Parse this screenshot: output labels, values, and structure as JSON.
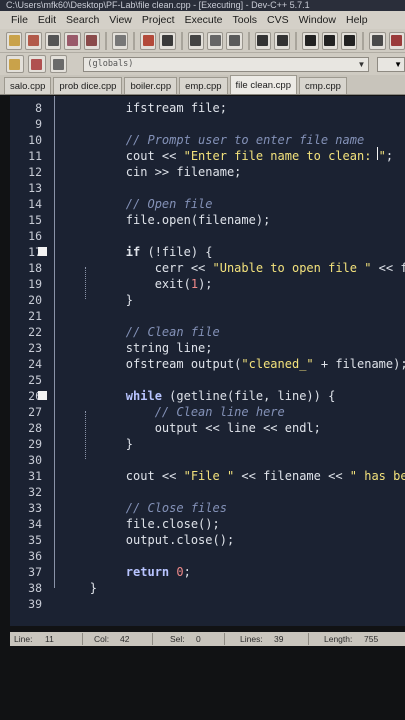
{
  "window": {
    "title": "C:\\Users\\mfk60\\Desktop\\PF-Lab\\file clean.cpp - [Executing] - Dev-C++ 5.7.1"
  },
  "menu": [
    "File",
    "Edit",
    "Search",
    "View",
    "Project",
    "Execute",
    "Tools",
    "CVS",
    "Window",
    "Help"
  ],
  "toolbar2": {
    "class_combo": "(globals)"
  },
  "tabs": [
    {
      "label": "salo.cpp",
      "active": false
    },
    {
      "label": "prob dice.cpp",
      "active": false
    },
    {
      "label": "boiler.cpp",
      "active": false
    },
    {
      "label": "emp.cpp",
      "active": false
    },
    {
      "label": "file clean.cpp",
      "active": true
    },
    {
      "label": "cmp.cpp",
      "active": false
    }
  ],
  "editor": {
    "lines": [
      {
        "n": "8",
        "code": [
          [
            "ind",
            "        "
          ],
          [
            "id",
            "ifstream file;"
          ]
        ]
      },
      {
        "n": "9",
        "code": []
      },
      {
        "n": "10",
        "code": [
          [
            "ind",
            "        "
          ],
          [
            "cm",
            "// Prompt user to enter file name"
          ]
        ]
      },
      {
        "n": "11",
        "code": [
          [
            "ind",
            "        "
          ],
          [
            "id",
            "cout << "
          ],
          [
            "str",
            "\"Enter file name to clean: \""
          ],
          [
            "id",
            ";"
          ]
        ]
      },
      {
        "n": "12",
        "code": [
          [
            "ind",
            "        "
          ],
          [
            "id",
            "cin >> filename;"
          ]
        ]
      },
      {
        "n": "13",
        "code": []
      },
      {
        "n": "14",
        "code": [
          [
            "ind",
            "        "
          ],
          [
            "cm",
            "// Open file"
          ]
        ]
      },
      {
        "n": "15",
        "code": [
          [
            "ind",
            "        "
          ],
          [
            "id",
            "file.open(filename);"
          ]
        ]
      },
      {
        "n": "16",
        "code": []
      },
      {
        "n": "17",
        "code": [
          [
            "ind",
            "        "
          ],
          [
            "kw",
            "if"
          ],
          [
            "id",
            " (!file) {"
          ]
        ]
      },
      {
        "n": "18",
        "code": [
          [
            "ind",
            "            "
          ],
          [
            "id",
            "cerr << "
          ],
          [
            "str",
            "\"Unable to open file \""
          ],
          [
            "id",
            " << file"
          ]
        ]
      },
      {
        "n": "19",
        "code": [
          [
            "ind",
            "            "
          ],
          [
            "id",
            "exit("
          ],
          [
            "num",
            "1"
          ],
          [
            "id",
            ");"
          ]
        ]
      },
      {
        "n": "20",
        "code": [
          [
            "ind",
            "        "
          ],
          [
            "id",
            "}"
          ]
        ]
      },
      {
        "n": "21",
        "code": []
      },
      {
        "n": "22",
        "code": [
          [
            "ind",
            "        "
          ],
          [
            "cm",
            "// Clean file"
          ]
        ]
      },
      {
        "n": "23",
        "code": [
          [
            "ind",
            "        "
          ],
          [
            "id",
            "string line;"
          ]
        ]
      },
      {
        "n": "24",
        "code": [
          [
            "ind",
            "        "
          ],
          [
            "id",
            "ofstream output("
          ],
          [
            "str",
            "\"cleaned_\""
          ],
          [
            "id",
            " + filename);"
          ]
        ]
      },
      {
        "n": "25",
        "code": []
      },
      {
        "n": "26",
        "code": [
          [
            "ind",
            "        "
          ],
          [
            "kwb",
            "while"
          ],
          [
            "id",
            " (getline(file, line)) {"
          ]
        ]
      },
      {
        "n": "27",
        "code": [
          [
            "ind",
            "            "
          ],
          [
            "cm",
            "// Clean line here"
          ]
        ]
      },
      {
        "n": "28",
        "code": [
          [
            "ind",
            "            "
          ],
          [
            "id",
            "output << line << endl;"
          ]
        ]
      },
      {
        "n": "29",
        "code": [
          [
            "ind",
            "        "
          ],
          [
            "id",
            "}"
          ]
        ]
      },
      {
        "n": "30",
        "code": []
      },
      {
        "n": "31",
        "code": [
          [
            "ind",
            "        "
          ],
          [
            "id",
            "cout << "
          ],
          [
            "str",
            "\"File \""
          ],
          [
            "id",
            " << filename << "
          ],
          [
            "str",
            "\" has been"
          ]
        ]
      },
      {
        "n": "32",
        "code": []
      },
      {
        "n": "33",
        "code": [
          [
            "ind",
            "        "
          ],
          [
            "cm",
            "// Close files"
          ]
        ]
      },
      {
        "n": "34",
        "code": [
          [
            "ind",
            "        "
          ],
          [
            "id",
            "file.close();"
          ]
        ]
      },
      {
        "n": "35",
        "code": [
          [
            "ind",
            "        "
          ],
          [
            "id",
            "output.close();"
          ]
        ]
      },
      {
        "n": "36",
        "code": []
      },
      {
        "n": "37",
        "code": [
          [
            "ind",
            "        "
          ],
          [
            "kwb",
            "return"
          ],
          [
            "id",
            " "
          ],
          [
            "num",
            "0"
          ],
          [
            "id",
            ";"
          ]
        ]
      },
      {
        "n": "38",
        "code": [
          [
            "ind",
            "   "
          ],
          [
            "id",
            "}"
          ]
        ]
      },
      {
        "n": "39",
        "code": []
      }
    ]
  },
  "status": {
    "line_label": "Line:",
    "line_value": "11",
    "col_label": "Col:",
    "col_value": "42",
    "sel_label": "Sel:",
    "sel_value": "0",
    "lines_label": "Lines:",
    "lines_value": "39",
    "length_label": "Length:",
    "length_value": "755"
  },
  "colors": {
    "editor_bg": "#1b2232",
    "string": "#f3e27c",
    "comment": "#8492b8",
    "number": "#f08a8a",
    "keyword_blue": "#b8c4ff"
  }
}
